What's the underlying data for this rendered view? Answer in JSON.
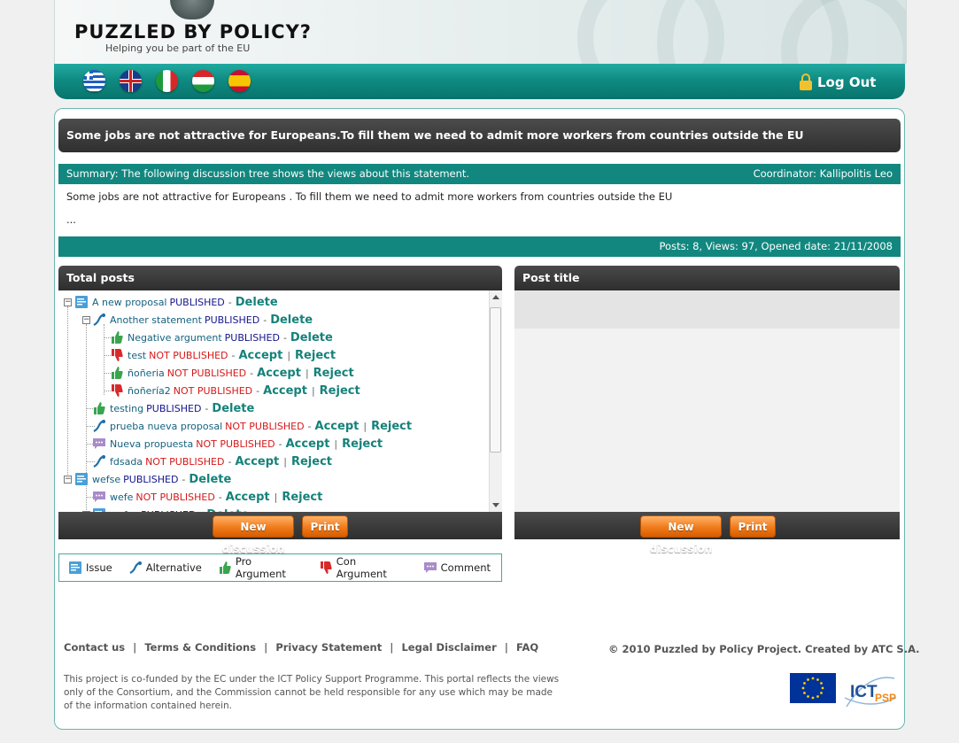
{
  "header": {
    "logo_text": "PUZZLED BY POLICY?",
    "tagline": "Helping you be part of the EU",
    "languages": [
      "Greek",
      "English",
      "Italian",
      "Hungarian",
      "Spanish"
    ],
    "logout_label": "Log Out",
    "colors": {
      "teal": "#12877f",
      "dark_bar": "#333333",
      "orange_button": "#f07a1a"
    }
  },
  "statement": {
    "title": "Some jobs are not attractive for Europeans.To fill them we need to admit more workers from countries outside the EU",
    "summary": "Summary: The following discussion tree shows the views about this statement.",
    "coordinator": "Coordinator: Kallipolitis Leo",
    "description": "Some jobs are not attractive for Europeans . To fill them we need to admit more workers from countries outside the EU",
    "ellipsis": "...",
    "stats": "Posts: 8, Views: 97, Opened date: 21/11/2008"
  },
  "total_posts": {
    "heading": "Total posts",
    "nodes": [
      {
        "type": "issue",
        "title": "A new proposal",
        "status": "PUBLISHED",
        "actions": [
          "Delete"
        ]
      },
      {
        "type": "alternative",
        "title": "Another statement",
        "status": "PUBLISHED",
        "actions": [
          "Delete"
        ]
      },
      {
        "type": "pro",
        "title": "Negative argument",
        "status": "PUBLISHED",
        "actions": [
          "Delete"
        ]
      },
      {
        "type": "con",
        "title": "test",
        "status": "NOT PUBLISHED",
        "actions": [
          "Accept",
          "Reject"
        ]
      },
      {
        "type": "pro",
        "title": "ñoñeria",
        "status": "NOT PUBLISHED",
        "actions": [
          "Accept",
          "Reject"
        ]
      },
      {
        "type": "con",
        "title": "ñoñería2",
        "status": "NOT PUBLISHED",
        "actions": [
          "Accept",
          "Reject"
        ]
      },
      {
        "type": "pro",
        "title": "testing",
        "status": "PUBLISHED",
        "actions": [
          "Delete"
        ]
      },
      {
        "type": "alternative",
        "title": "prueba nueva proposal",
        "status": "NOT PUBLISHED",
        "actions": [
          "Accept",
          "Reject"
        ]
      },
      {
        "type": "comment",
        "title": "Nueva propuesta",
        "status": "NOT PUBLISHED",
        "actions": [
          "Accept",
          "Reject"
        ]
      },
      {
        "type": "alternative",
        "title": "fdsada",
        "status": "NOT PUBLISHED",
        "actions": [
          "Accept",
          "Reject"
        ]
      },
      {
        "type": "issue",
        "title": "wefse",
        "status": "PUBLISHED",
        "actions": [
          "Delete"
        ]
      },
      {
        "type": "comment",
        "title": "wefe",
        "status": "NOT PUBLISHED",
        "actions": [
          "Accept",
          "Reject"
        ]
      },
      {
        "type": "issue",
        "title": "wefse",
        "status": "PUBLISHED",
        "actions": [
          "Delete"
        ]
      }
    ],
    "new_discussion_label": "New discussion",
    "print_label": "Print"
  },
  "post_panel": {
    "heading": "Post title",
    "new_discussion_label": "New discussion",
    "print_label": "Print"
  },
  "legend": [
    {
      "icon": "issue-icon",
      "label": "Issue"
    },
    {
      "icon": "alternative-icon",
      "label": "Alternative"
    },
    {
      "icon": "pro-argument-icon",
      "label": "Pro Argument"
    },
    {
      "icon": "con-argument-icon",
      "label": "Con Argument"
    },
    {
      "icon": "comment-icon",
      "label": "Comment"
    }
  ],
  "footer": {
    "links": [
      "Contact us",
      "Terms & Conditions",
      "Privacy Statement",
      "Legal Disclaimer",
      "FAQ"
    ],
    "copyright": "© 2010 Puzzled by Policy Project. Created by ATC S.A.",
    "disclaimer": "This project is co-funded by the EC under the ICT Policy Support Programme. This portal reflects the views only of the Consortium, and the Commission cannot be held responsible for any use which may be made of the information contained herein.",
    "ict_logo_text": "ICT PSP"
  }
}
